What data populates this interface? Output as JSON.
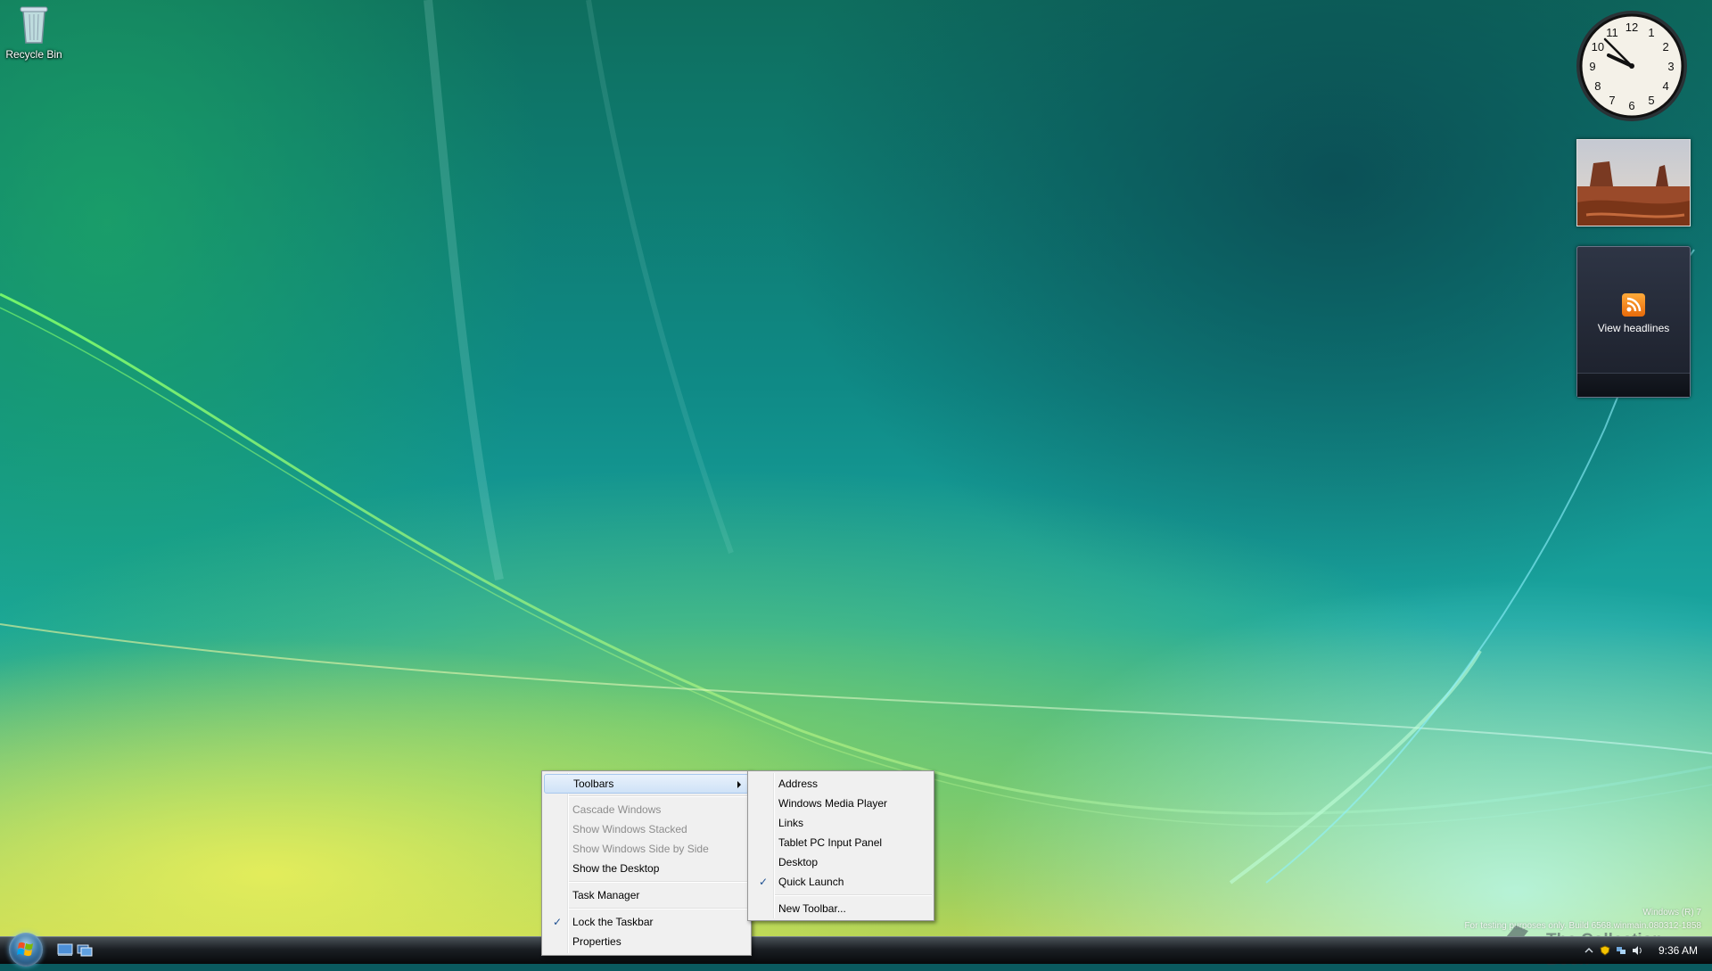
{
  "desktop": {
    "icons": [
      {
        "label": "Recycle Bin",
        "icon": "recycle-bin-icon"
      }
    ]
  },
  "gadgets": {
    "clock": {
      "numbers": [
        "12",
        "1",
        "2",
        "3",
        "4",
        "5",
        "6",
        "7",
        "8",
        "9",
        "10",
        "11"
      ]
    },
    "feed": {
      "label": "View headlines",
      "icon": "rss-icon"
    }
  },
  "context_menu": {
    "items": [
      {
        "label": "Toolbars",
        "has_submenu": true,
        "highlighted": true
      },
      {
        "label": "Cascade Windows",
        "disabled": true
      },
      {
        "label": "Show Windows Stacked",
        "disabled": true
      },
      {
        "label": "Show Windows Side by Side",
        "disabled": true
      },
      {
        "label": "Show the Desktop"
      },
      {
        "label": "Task Manager"
      },
      {
        "label": "Lock the Taskbar",
        "checked": true
      },
      {
        "label": "Properties"
      }
    ]
  },
  "toolbars_submenu": {
    "items": [
      {
        "label": "Address"
      },
      {
        "label": "Windows Media Player"
      },
      {
        "label": "Links"
      },
      {
        "label": "Tablet PC Input Panel"
      },
      {
        "label": "Desktop"
      },
      {
        "label": "Quick Launch",
        "checked": true
      },
      {
        "label": "New Toolbar..."
      }
    ]
  },
  "watermark": {
    "line1": "Windows (R) 7",
    "line2": "For testing purposes only. Build 6568.winmain.080312-1858"
  },
  "brand": {
    "text": "The Collection Book"
  },
  "taskbar": {
    "clock": "9:36 AM",
    "check_glyph": "✓"
  }
}
